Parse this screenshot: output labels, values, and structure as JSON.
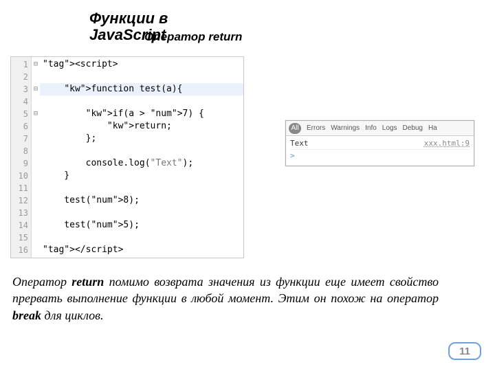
{
  "title_line1": "Функции в",
  "title_line2": "JavaScript",
  "subtitle": "Оператор return",
  "code": {
    "lines": [
      "<script>",
      "",
      "    function test(a){",
      "",
      "        if(a > 7) {",
      "            return;",
      "        };",
      "",
      "        console.log(\"Text\");",
      "    }",
      "",
      "    test(8);",
      "",
      "    test(5);",
      "",
      "</script>"
    ],
    "fold_markers": {
      "1": "⊟",
      "3": "⊟",
      "5": "⊟"
    }
  },
  "console": {
    "tabs": [
      "All",
      "Errors",
      "Warnings",
      "Info",
      "Logs",
      "Debug",
      "Ha"
    ],
    "entries": [
      {
        "text": "Text",
        "src": "xxx.html:9"
      }
    ],
    "prompt": ">"
  },
  "description_parts": {
    "p1": "Оператор ",
    "kw1": "return",
    "p2": " помимо возврата значения из функции еще имеет свойство прервать выполнение функции в любой момент. Этим он похож на оператор ",
    "kw2": "break",
    "p3": " для циклов."
  },
  "page_number": "11"
}
